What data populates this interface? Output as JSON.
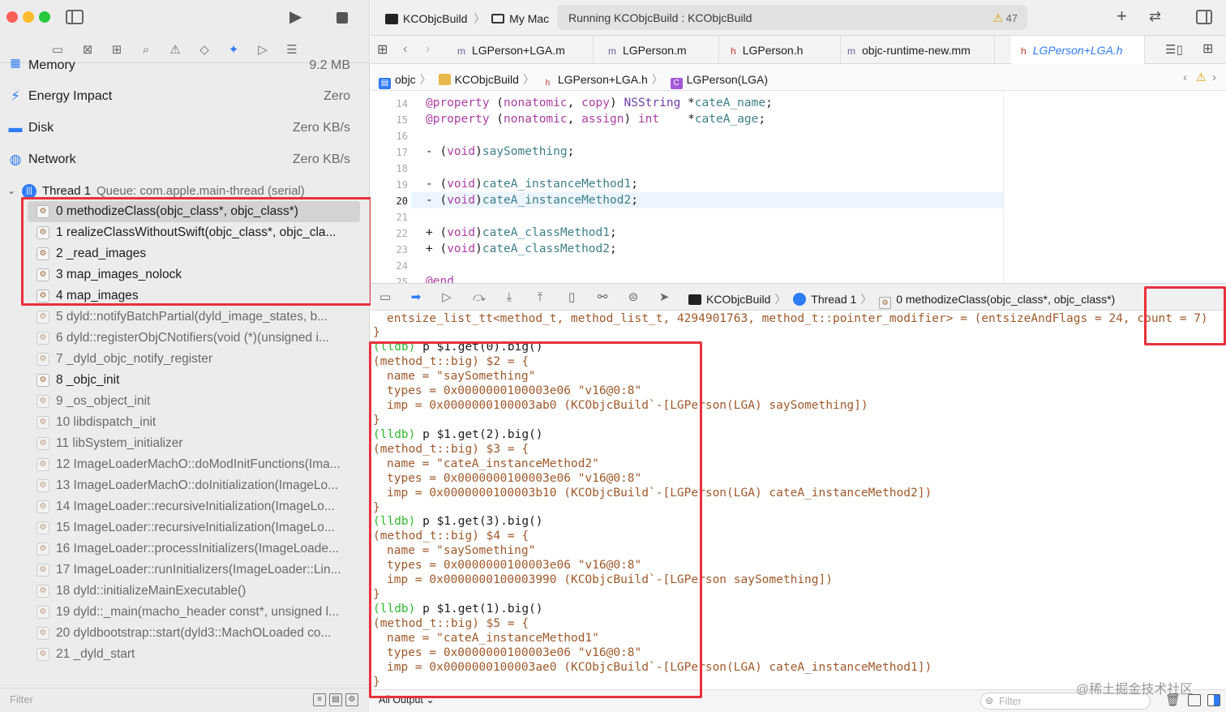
{
  "left_panel": {
    "gauges": [
      {
        "name": "Memory",
        "value": "9.2 MB",
        "icon": "memory-icon"
      },
      {
        "name": "Energy Impact",
        "value": "Zero",
        "icon": "energy-bolt-icon"
      },
      {
        "name": "Disk",
        "value": "Zero KB/s",
        "icon": "disk-icon"
      },
      {
        "name": "Network",
        "value": "Zero KB/s",
        "icon": "network-globe-icon"
      }
    ],
    "thread": {
      "name": "Thread 1",
      "queue": "Queue: com.apple.main-thread (serial)"
    },
    "frames": [
      "0 methodizeClass(objc_class*, objc_class*)",
      "1 realizeClassWithoutSwift(objc_class*, objc_cla...",
      "2 _read_images",
      "3 map_images_nolock",
      "4 map_images",
      "5 dyld::notifyBatchPartial(dyld_image_states, b...",
      "6 dyld::registerObjCNotifiers(void (*)(unsigned i...",
      "7 _dyld_objc_notify_register",
      "8 _objc_init",
      "9 _os_object_init",
      "10 libdispatch_init",
      "11 libSystem_initializer",
      "12 ImageLoaderMachO::doModInitFunctions(Ima...",
      "13 ImageLoaderMachO::doInitialization(ImageLo...",
      "14 ImageLoader::recursiveInitialization(ImageLo...",
      "15 ImageLoader::recursiveInitialization(ImageLo...",
      "16 ImageLoader::processInitializers(ImageLoade...",
      "17 ImageLoader::runInitializers(ImageLoader::Lin...",
      "18 dyld::initializeMainExecutable()",
      "19 dyld::_main(macho_header const*, unsigned l...",
      "20 dyldbootstrap::start(dyld3::MachOLoaded co...",
      "21 _dyld_start"
    ],
    "filter_placeholder": "Filter"
  },
  "toolbar": {
    "scheme": "KCObjcBuild",
    "destination": "My Mac",
    "status": "Running KCObjcBuild : KCObjcBuild",
    "warning_count": "47"
  },
  "tabs": [
    {
      "kind": "m",
      "label": "LGPerson+LGA.m"
    },
    {
      "kind": "m",
      "label": "LGPerson.m"
    },
    {
      "kind": "h",
      "label": "LGPerson.h"
    },
    {
      "kind": "m",
      "label": "objc-runtime-new.mm"
    },
    {
      "kind": "h",
      "label": "LGPerson+LGA.h"
    }
  ],
  "jumpbar": {
    "crumbs": [
      "objc",
      "KCObjcBuild",
      "LGPerson+LGA.h",
      "LGPerson(LGA)"
    ]
  },
  "editor": {
    "line_numbers": [
      "14",
      "15",
      "16",
      "17",
      "18",
      "19",
      "20",
      "21",
      "22",
      "23",
      "24",
      "25"
    ],
    "current_line": "20"
  },
  "debug_bar": {
    "crumbs": [
      "KCObjcBuild",
      "Thread 1",
      "0 methodizeClass(objc_class*, objc_class*)"
    ]
  },
  "console": {
    "first_line_a": "entsize_list_tt<method_t, method_list_t, 4294901763, method_t::pointer_modifier> = (entsizeAndFlags = 24,",
    "first_line_b": "count = 7)",
    "close_brace": "}",
    "entries": [
      {
        "cmd": "p $1.get(0).big()",
        "decl": "(method_t::big) $2 = {",
        "name": "name = \"saySomething\"",
        "types": "types = 0x0000000100003e06 \"v16@0:8\"",
        "imp": "imp = 0x0000000100003ab0 (KCObjcBuild`-[LGPerson(LGA) saySomething])"
      },
      {
        "cmd": "p $1.get(2).big()",
        "decl": "(method_t::big) $3 = {",
        "name": "name = \"cateA_instanceMethod2\"",
        "types": "types = 0x0000000100003e06 \"v16@0:8\"",
        "imp": "imp = 0x0000000100003b10 (KCObjcBuild`-[LGPerson(LGA) cateA_instanceMethod2])"
      },
      {
        "cmd": "p $1.get(3).big()",
        "decl": "(method_t::big) $4 = {",
        "name": "name = \"saySomething\"",
        "types": "types = 0x0000000100003e06 \"v16@0:8\"",
        "imp": "imp = 0x0000000100003990 (KCObjcBuild`-[LGPerson saySomething])"
      },
      {
        "cmd": "p $1.get(1).big()",
        "decl": "(method_t::big) $5 = {",
        "name": "name = \"cateA_instanceMethod1\"",
        "types": "types = 0x0000000100003e06 \"v16@0:8\"",
        "imp": "imp = 0x0000000100003ae0 (KCObjcBuild`-[LGPerson(LGA) cateA_instanceMethod1])"
      }
    ],
    "lldb_prompt": "(lldb)",
    "all_output": "All Output ⌄",
    "filter_placeholder": "Filter",
    "watermark": "@稀土掘金技术社区"
  },
  "colors": {
    "accent": "#2f7cf6",
    "annotation_red": "#e8313c",
    "lldb_green": "#2fb82f",
    "console_brown": "#a0592a",
    "keyword_pink": "#ad3da4",
    "type_purple": "#703daa"
  }
}
